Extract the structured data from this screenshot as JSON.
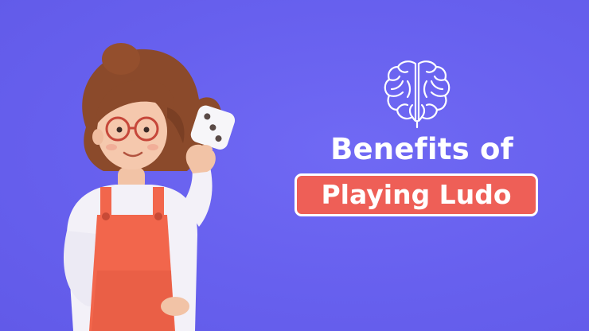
{
  "headline": {
    "line1": "Benefits of",
    "line2": "Playing Ludo"
  },
  "icons": {
    "brain": "brain-outline-icon",
    "dice": "dice-icon"
  },
  "colors": {
    "background": "#6a63f0",
    "pill": "#ee5f57",
    "text": "#ffffff",
    "apron": "#f2664c",
    "hair": "#8b4a2b"
  }
}
